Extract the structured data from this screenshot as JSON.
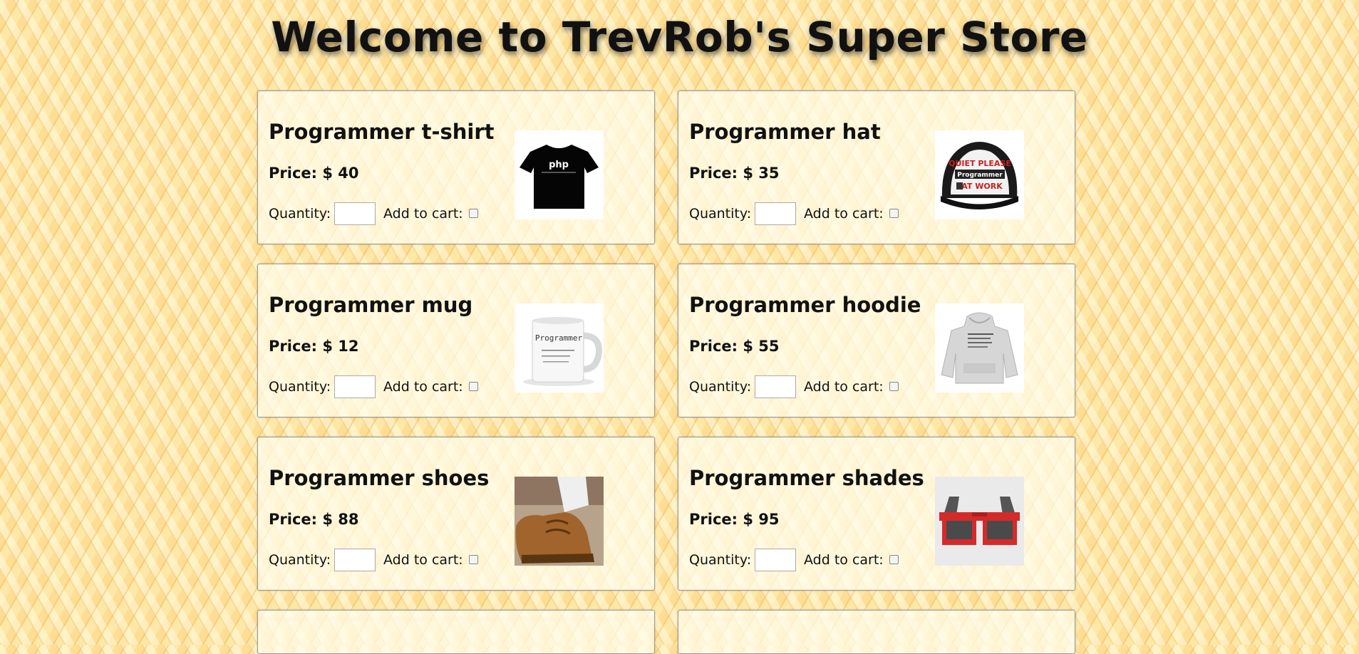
{
  "page": {
    "title": "Welcome to TrevRob's Super Store"
  },
  "labels": {
    "price_prefix": "Price: $",
    "quantity": "Quantity:",
    "add_to_cart": "Add to cart:"
  },
  "products": [
    {
      "name": "Programmer t-shirt",
      "price": "Price: $ 40",
      "image": "black-tshirt-php-image"
    },
    {
      "name": "Programmer hat",
      "price": "Price: $ 35",
      "image": "trucker-hat-quiet-please-image",
      "image_text": [
        "QUIET PLEASE",
        "Programmer",
        "AT WORK"
      ]
    },
    {
      "name": "Programmer mug",
      "price": "Price: $ 12",
      "image": "white-mug-image",
      "image_text": [
        "Programmer"
      ]
    },
    {
      "name": "Programmer hoodie",
      "price": "Price: $ 55",
      "image": "grey-hoodie-image"
    },
    {
      "name": "Programmer shoes",
      "price": "Price: $ 88",
      "image": "brown-shoes-image"
    },
    {
      "name": "Programmer shades",
      "price": "Price: $ 95",
      "image": "pixel-sunglasses-image"
    }
  ],
  "colors": {
    "background": "#fde8a8",
    "card_bg": "#fffcec",
    "card_border": "#9a9a9a"
  }
}
